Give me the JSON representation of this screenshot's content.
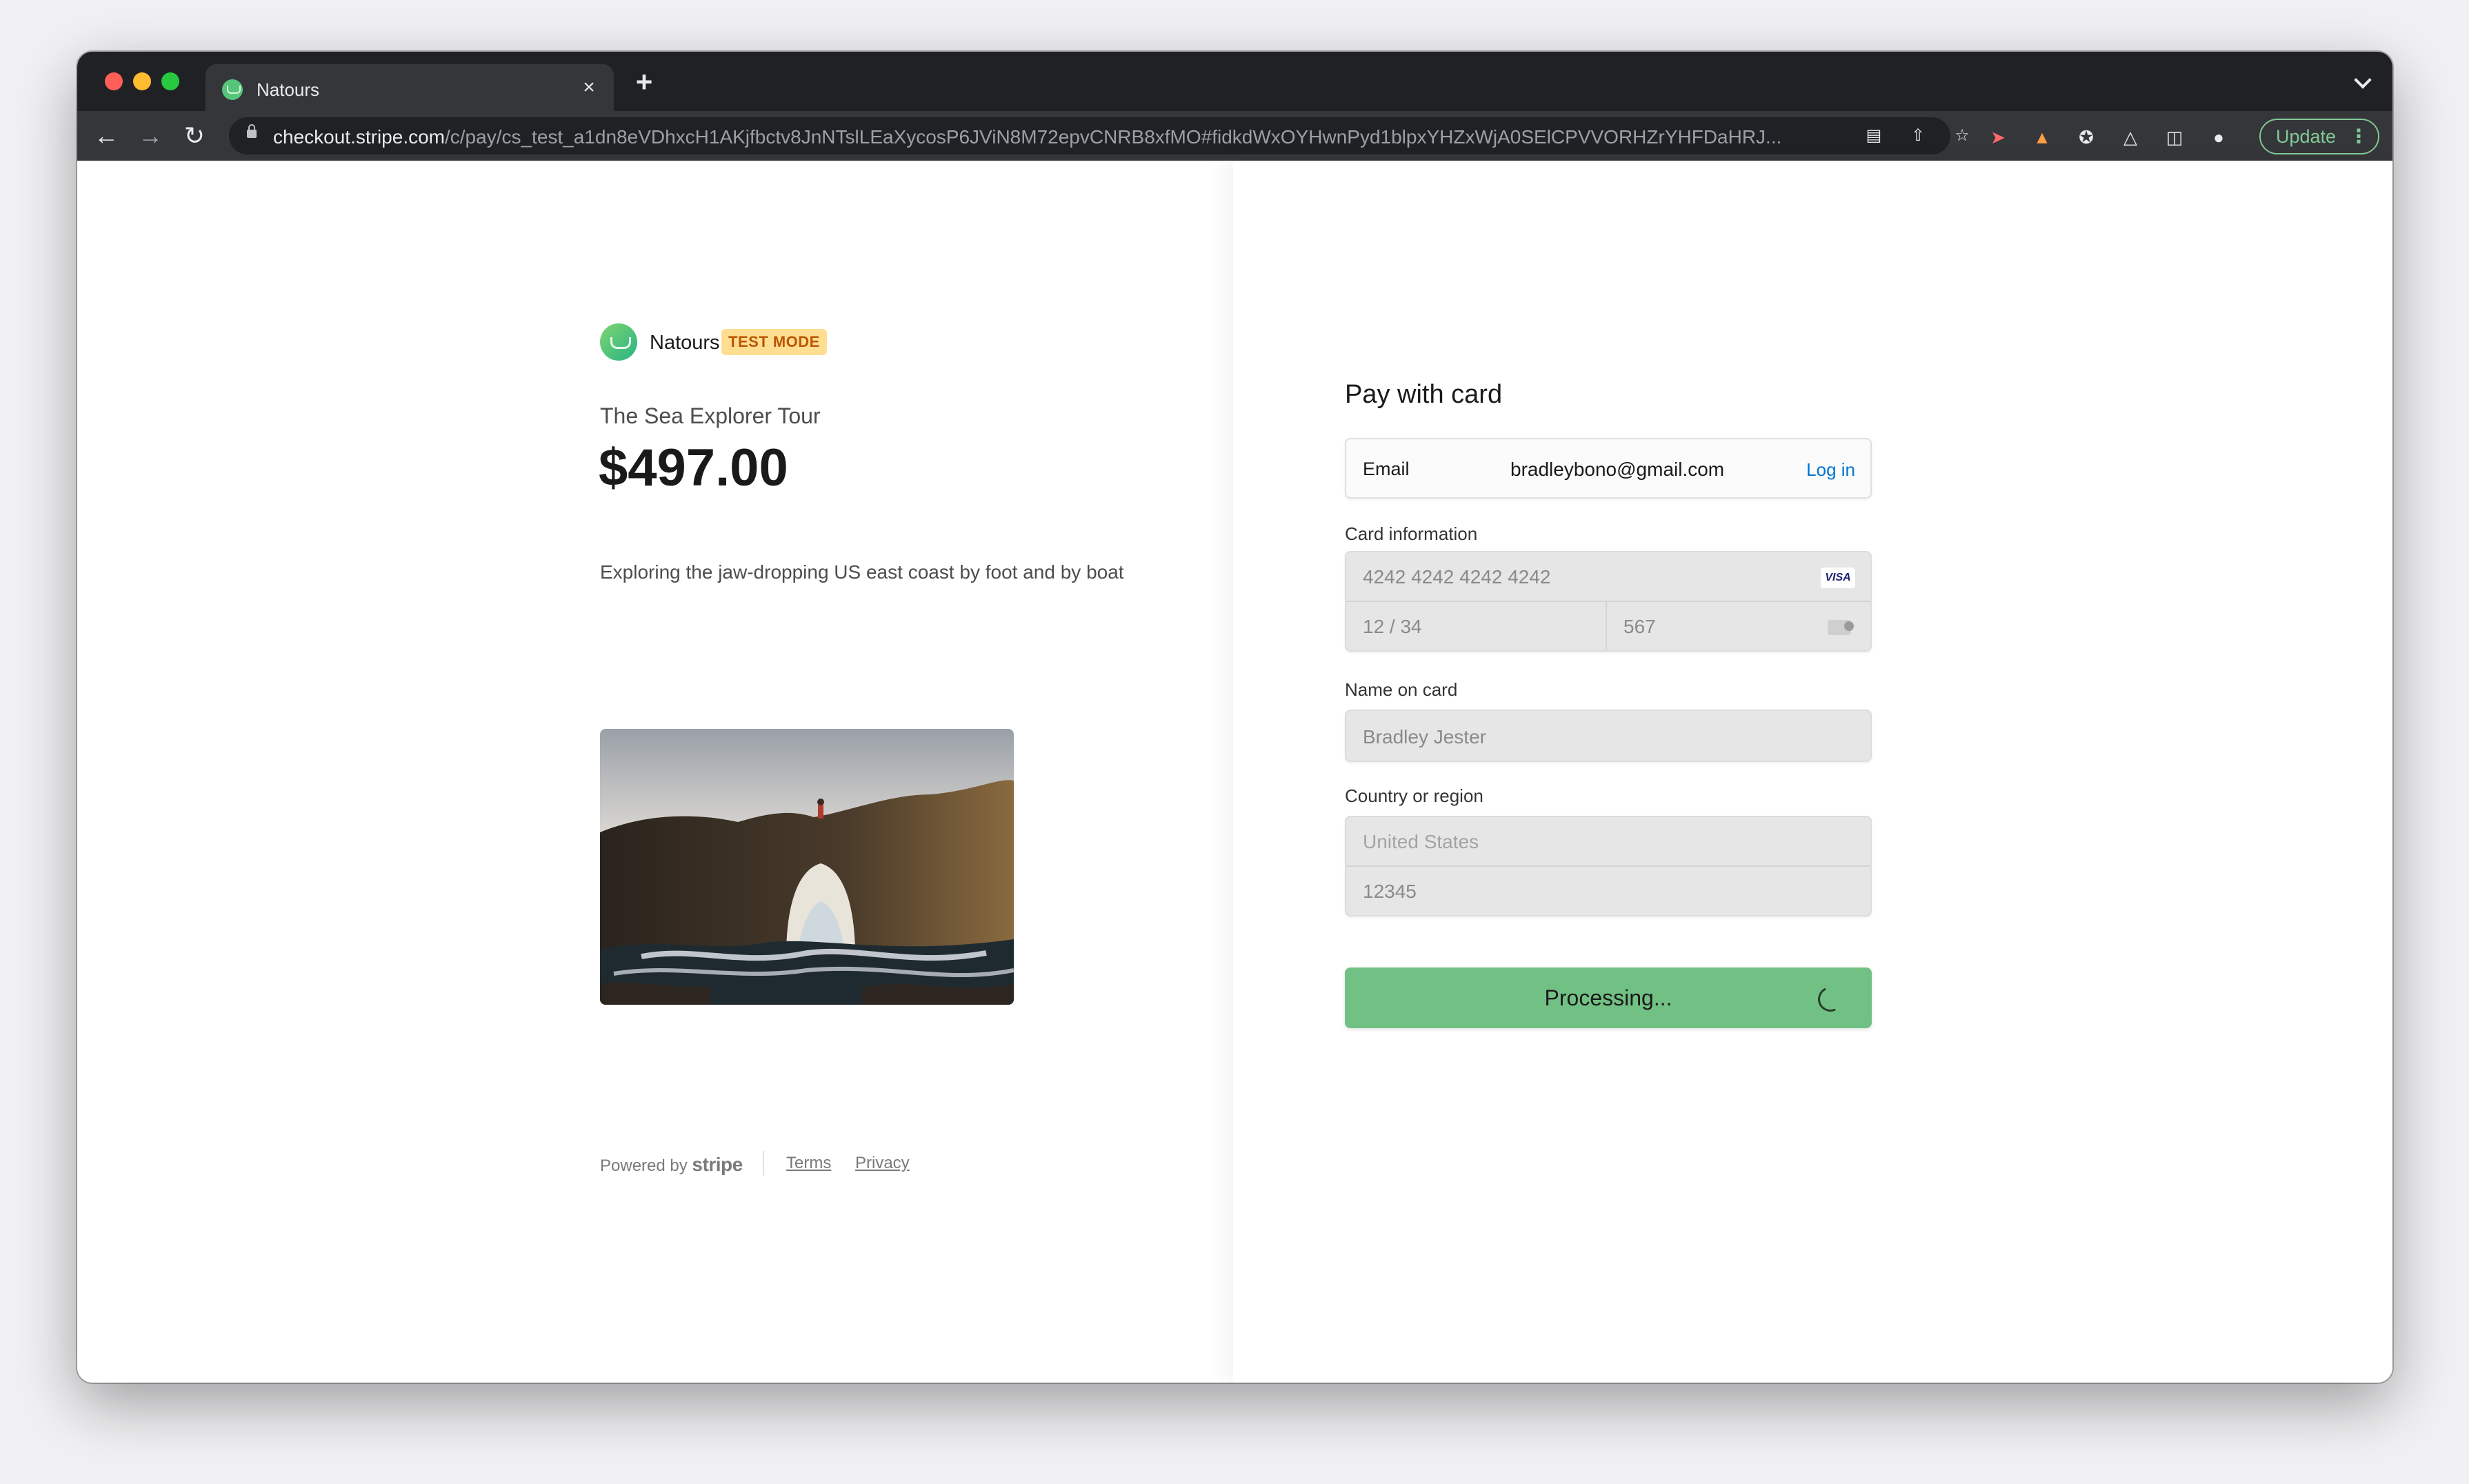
{
  "browser": {
    "tab_title": "Natours",
    "tab_close": "×",
    "new_tab": "+",
    "url_host": "checkout.stripe.com",
    "url_path": "/c/pay/cs_test_a1dn8eVDhxcH1AKjfbctv8JnNTslLEaXycosP6JViN8M72epvCNRB8xfMO#fidkdWxOYHwnPyd1blpxYHZxWjA0SElCPVVORHZrYHFDaHRJ...",
    "update_label": "Update",
    "icons": [
      "back-arrow",
      "forward-arrow",
      "reload",
      "lock",
      "card",
      "share",
      "star",
      "extension-red",
      "extension-orange",
      "puzzle",
      "flask",
      "sidebar",
      "profile",
      "menu-dots"
    ]
  },
  "merchant": {
    "name": "Natours",
    "badge": "TEST MODE"
  },
  "product": {
    "name": "The Sea Explorer Tour",
    "price": "$497.00",
    "description": "Exploring the jaw-dropping US east coast by foot and by boat"
  },
  "footer": {
    "powered_by": "Powered by",
    "brand": "stripe",
    "terms": "Terms",
    "privacy": "Privacy"
  },
  "form": {
    "title": "Pay with card",
    "email_label": "Email",
    "email_value": "bradleybono@gmail.com",
    "login_label": "Log in",
    "card_label": "Card information",
    "card_number": "4242 4242 4242 4242",
    "card_brand": "VISA",
    "card_expiry": "12 / 34",
    "card_cvc": "567",
    "name_label": "Name on card",
    "name_value": "Bradley Jester",
    "country_label": "Country or region",
    "country_value": "United States",
    "postal_value": "12345",
    "submit_label": "Processing..."
  },
  "colors": {
    "accent": "#72c184",
    "badge_bg": "#ffde92",
    "badge_text": "#bb5504",
    "link": "#0074d4"
  }
}
